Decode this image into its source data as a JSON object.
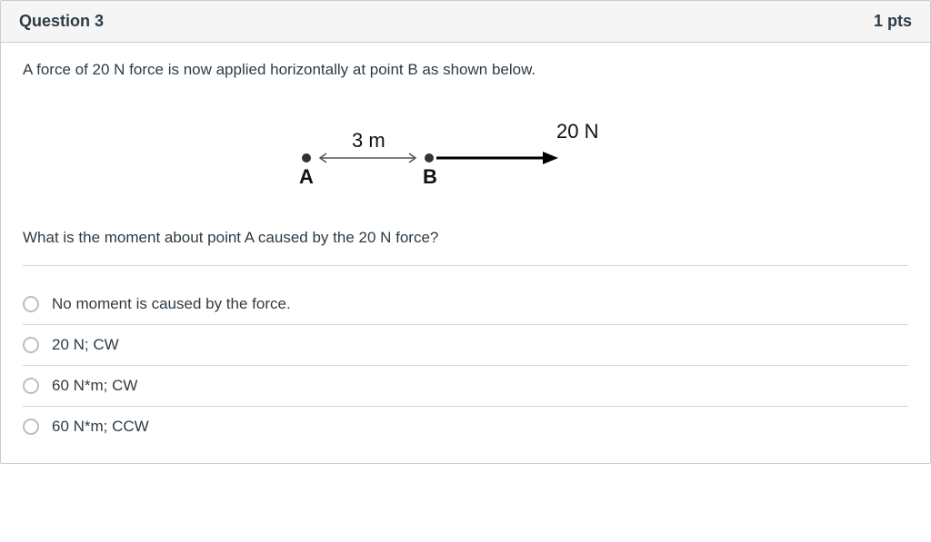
{
  "header": {
    "title": "Question 3",
    "points": "1 pts"
  },
  "body": {
    "intro": "A force of 20 N force is now applied horizontally at point B as shown below.",
    "question": "What is the moment about point A caused by the 20 N force?"
  },
  "diagram": {
    "distance_label": "3 m",
    "point_a_label": "A",
    "point_b_label": "B",
    "force_label": "20 N"
  },
  "options": [
    {
      "label": "No moment is caused by the force."
    },
    {
      "label": "20 N; CW"
    },
    {
      "label": "60 N*m; CW"
    },
    {
      "label": "60 N*m; CCW"
    }
  ]
}
